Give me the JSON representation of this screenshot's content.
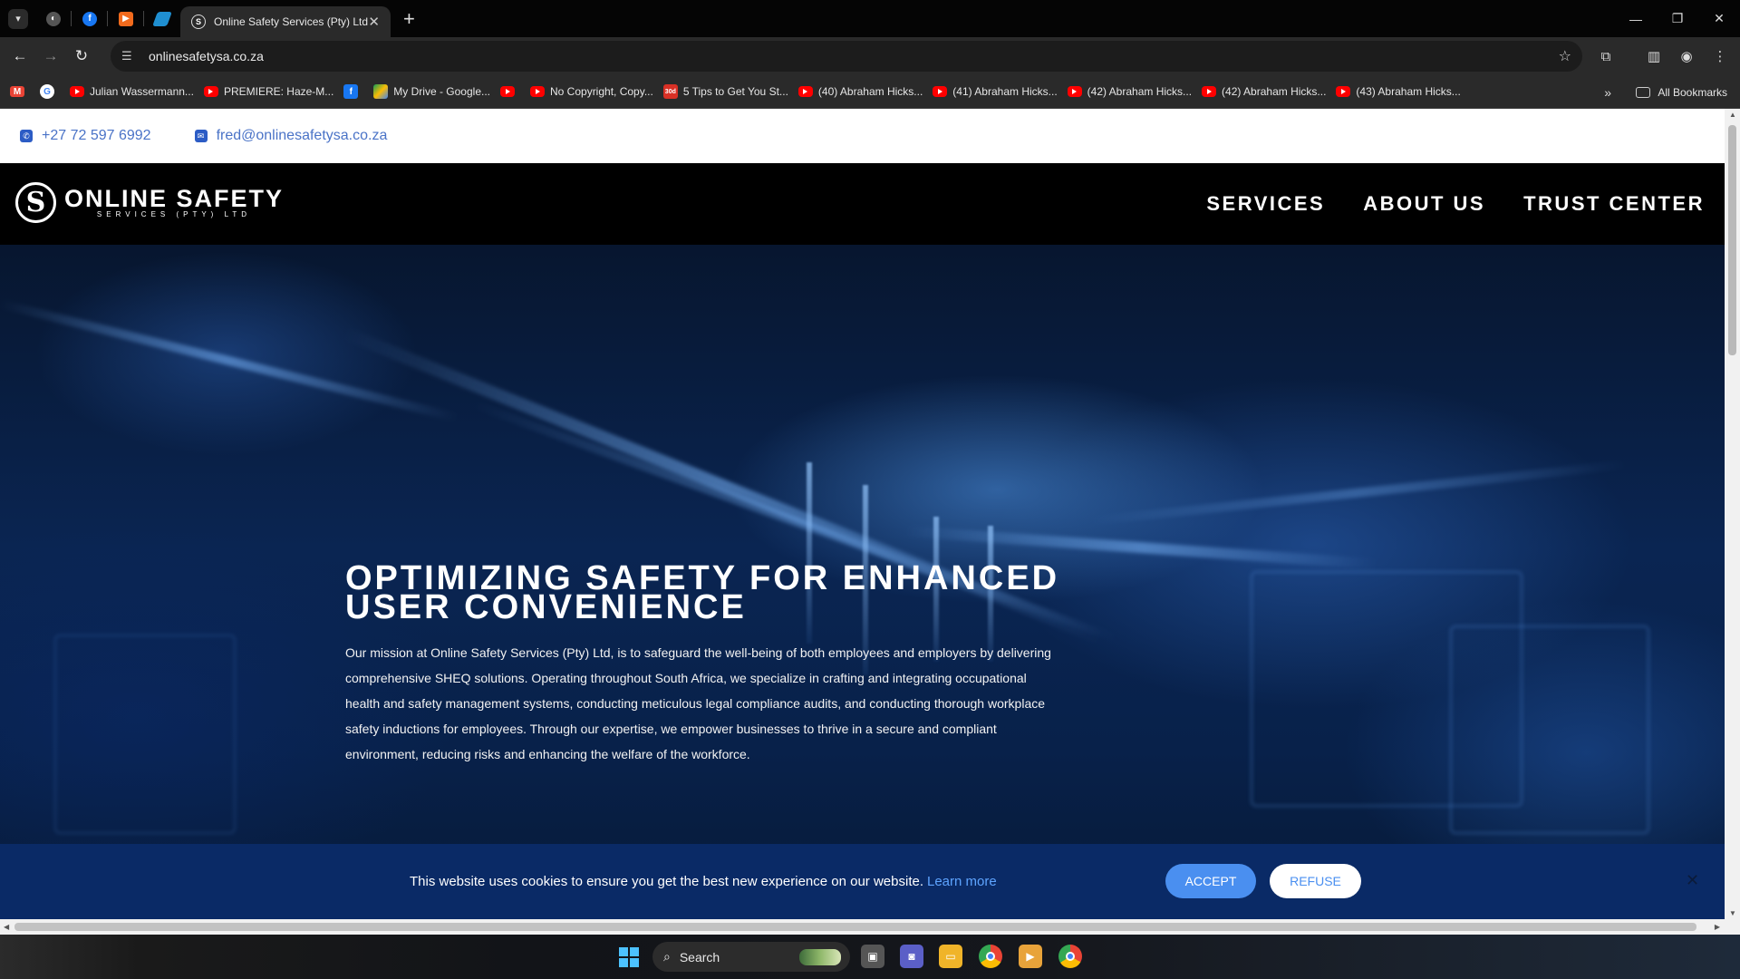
{
  "browser": {
    "active_tab_title": "Online Safety Services (Pty) Ltd",
    "url": "onlinesafetysa.co.za",
    "bookmarks": [
      "Julian Wassermann...",
      "PREMIERE: Haze-M...",
      "My Drive - Google...",
      "No Copyright, Copy...",
      "5 Tips to Get You St...",
      "(40) Abraham Hicks...",
      "(41) Abraham Hicks...",
      "(42) Abraham Hicks...",
      "(42) Abraham Hicks...",
      "(43) Abraham Hicks..."
    ],
    "all_bookmarks": "All Bookmarks"
  },
  "topbar": {
    "phone": "+27 72 597 6992",
    "email": "fred@onlinesafetysa.co.za"
  },
  "header": {
    "logo_name": "ONLINE SAFETY",
    "logo_sub": "SERVICES (PTY) LTD",
    "logo_letter": "S",
    "nav": [
      "SERVICES",
      "ABOUT US",
      "TRUST CENTER"
    ]
  },
  "hero": {
    "title": "OPTIMIZING SAFETY FOR ENHANCED USER CONVENIENCE",
    "text": "Our mission at Online Safety Services (Pty) Ltd, is to safeguard the well-being of both employees and employers by delivering comprehensive SHEQ solutions. Operating throughout South Africa, we specialize in crafting and integrating occupational health and safety management systems, conducting meticulous legal compliance audits, and conducting thorough workplace safety inductions for employees. Through our expertise, we empower businesses to thrive in a secure and compliant environment, reducing risks and enhancing the welfare of the workforce."
  },
  "cookie": {
    "message": "This website uses cookies to ensure you get the best new experience on our website.",
    "learn_more": "Learn more",
    "accept": "ACCEPT",
    "refuse": "REFUSE"
  },
  "taskbar": {
    "search_label": "Search"
  },
  "colors": {
    "accent_blue": "#4a8ff0",
    "cookie_bg": "#0a2a66",
    "link_blue": "#4a73c7"
  }
}
